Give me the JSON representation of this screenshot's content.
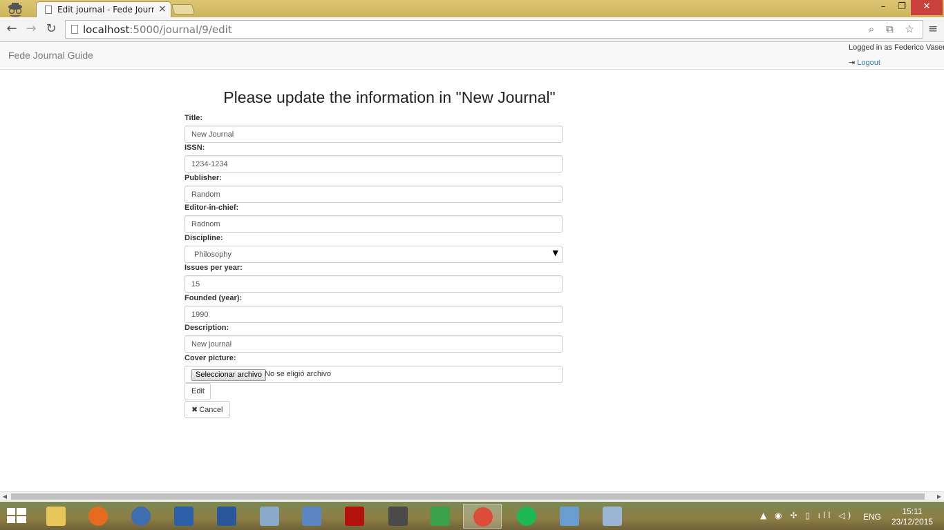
{
  "browser": {
    "tab_title": "Edit journal - Fede Journal Guide",
    "tab_close": "×",
    "url_host": "localhost",
    "url_path": ":5000/journal/9/edit",
    "back_glyph": "←",
    "forward_glyph": "→",
    "reload_glyph": "↻",
    "menu_glyph": "≡",
    "omnibox_icons": "⌕ ⧉ ☆",
    "window_min": "–",
    "window_max": "❐",
    "window_close": "✕"
  },
  "navbar": {
    "brand": "Fede Journal Guide",
    "logged_in_text": "Logged in as Federico Vasen",
    "logout_icon": "⇥",
    "logout_label": "Logout"
  },
  "form": {
    "heading": "Please update the information in \"New Journal\"",
    "fields": {
      "title": {
        "label": "Title:",
        "value": "New Journal"
      },
      "issn": {
        "label": "ISSN:",
        "value": "1234-1234"
      },
      "publisher": {
        "label": "Publisher:",
        "value": "Random"
      },
      "editor": {
        "label": "Editor-in-chief:",
        "value": "Radnom"
      },
      "discipline": {
        "label": "Discipline:",
        "value": "Philosophy",
        "arrow": "▼"
      },
      "issues": {
        "label": "Issues per year:",
        "value": "15"
      },
      "founded": {
        "label": "Founded (year):",
        "value": "1990"
      },
      "description": {
        "label": "Description:",
        "value": "New journal"
      },
      "cover": {
        "label": "Cover picture:",
        "button_label": "Seleccionar archivo",
        "status": "No se eligió archivo"
      }
    },
    "edit_button": "Edit",
    "cancel_icon": "✖",
    "cancel_button": "Cancel"
  },
  "scrollbar": {
    "left_arrow": "◀",
    "right_arrow": "▶"
  },
  "taskbar": {
    "apps": [
      {
        "name": "file-explorer",
        "color": "#e8c65a"
      },
      {
        "name": "firefox",
        "color": "#e66b1e"
      },
      {
        "name": "thunderbird",
        "color": "#3d6fb0"
      },
      {
        "name": "wordpad",
        "color": "#2b5fa8"
      },
      {
        "name": "word",
        "color": "#2b579a"
      },
      {
        "name": "remote-desktop",
        "color": "#8aa8c8"
      },
      {
        "name": "calculator",
        "color": "#5a86c4"
      },
      {
        "name": "adobe-reader",
        "color": "#b3120e"
      },
      {
        "name": "sublime-text",
        "color": "#4a4a4a"
      },
      {
        "name": "git",
        "color": "#3aa04a"
      },
      {
        "name": "chrome",
        "color": "#dd4b39"
      },
      {
        "name": "spotify",
        "color": "#1db954"
      },
      {
        "name": "paint",
        "color": "#6a9ed0"
      },
      {
        "name": "snipping-tool",
        "color": "#9ab4d4"
      }
    ],
    "tray_icons": "▲ ◉ ✣ ▯ ıll ◁)",
    "language": "ENG",
    "time": "15:11",
    "date": "23/12/2015"
  }
}
